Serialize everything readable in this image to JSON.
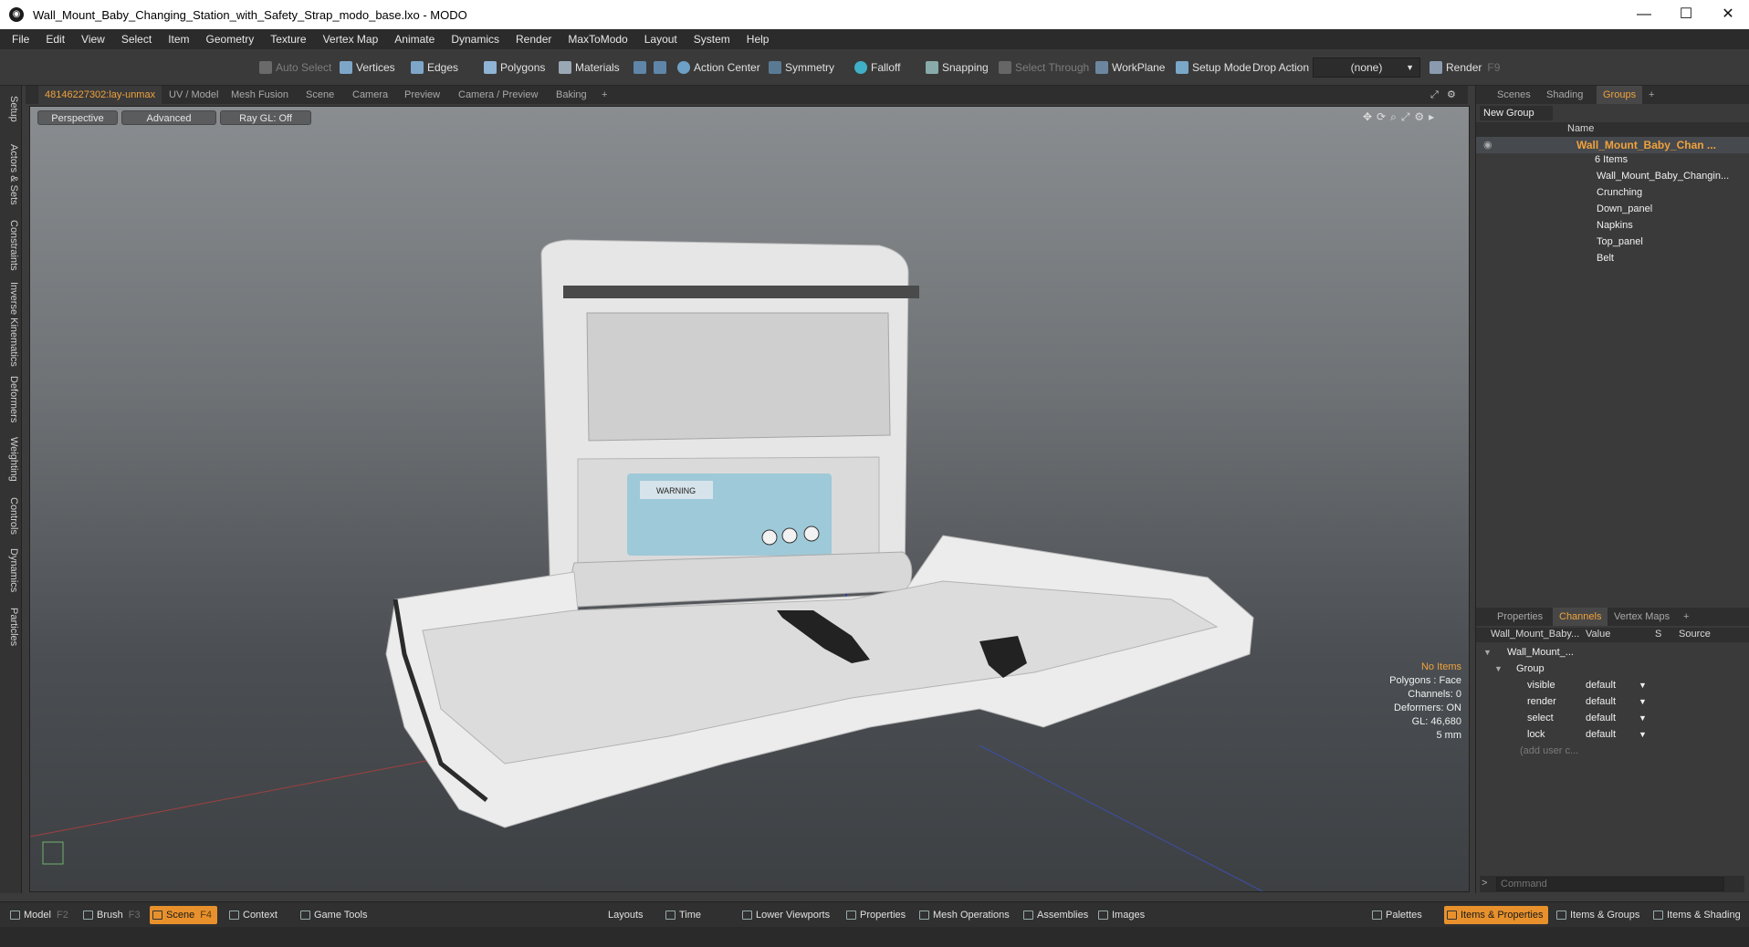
{
  "window": {
    "title": "Wall_Mount_Baby_Changing_Station_with_Safety_Strap_modo_base.lxo - MODO",
    "minimize": "—",
    "maximize": "☐",
    "close": "✕"
  },
  "menu": [
    "File",
    "Edit",
    "View",
    "Select",
    "Item",
    "Geometry",
    "Texture",
    "Vertex Map",
    "Animate",
    "Dynamics",
    "Render",
    "MaxToModo",
    "Layout",
    "System",
    "Help"
  ],
  "toolbar": {
    "auto_select": "Auto Select",
    "vertices": "Vertices",
    "edges": "Edges",
    "polygons": "Polygons",
    "materials": "Materials",
    "action_center": "Action Center",
    "symmetry": "Symmetry",
    "falloff": "Falloff",
    "snapping": "Snapping",
    "select_through": "Select Through",
    "workplane": "WorkPlane",
    "setup_mode": "Setup Mode",
    "drop_action_label": "Drop Action",
    "drop_action_value": "(none)",
    "render": "Render",
    "render_key": "F9"
  },
  "left_tabs": [
    "Setup",
    "Actors & Sets",
    "Constraints",
    "Inverse Kinematics",
    "Deformers",
    "Weighting",
    "Controls",
    "Dynamics",
    "Particles"
  ],
  "viewport_tabs": [
    "48146227302:lay-unmax",
    "UV / Model",
    "Mesh Fusion",
    "Scene",
    "Camera",
    "Preview",
    "Camera / Preview",
    "Baking",
    "+"
  ],
  "viewport": {
    "perspective": "Perspective",
    "advanced": "Advanced",
    "raygl": "Ray GL: Off",
    "hud": {
      "no_items": "No Items",
      "polygons": "Polygons : Face",
      "channels": "Channels: 0",
      "deformers": "Deformers: ON",
      "gl": "GL: 46,680",
      "unit": "5 mm"
    },
    "warning_label": "WARNING"
  },
  "scene_panel": {
    "tabs": [
      "Scenes",
      "Shading",
      "Groups",
      "+"
    ],
    "new_group": "New Group",
    "name_header": "Name",
    "root": "Wall_Mount_Baby_Chan ...",
    "root_count": "6 Items",
    "items": [
      "Wall_Mount_Baby_Changin...",
      "Crunching",
      "Down_panel",
      "Napkins",
      "Top_panel",
      "Belt"
    ]
  },
  "channels_panel": {
    "tabs": [
      "Properties",
      "Channels",
      "Vertex Maps",
      "+"
    ],
    "headers": {
      "name": "Wall_Mount_Baby...",
      "value": "Value",
      "s": "S",
      "source": "Source"
    },
    "root": "Wall_Mount_...",
    "group": "Group",
    "rows": [
      {
        "name": "visible",
        "value": "default"
      },
      {
        "name": "render",
        "value": "default"
      },
      {
        "name": "select",
        "value": "default"
      },
      {
        "name": "lock",
        "value": "default"
      }
    ],
    "add_user": "(add user c...",
    "command_placeholder": "Command"
  },
  "bottom": {
    "model": "Model",
    "model_key": "F2",
    "brush": "Brush",
    "brush_key": "F3",
    "scene": "Scene",
    "scene_key": "F4",
    "context": "Context",
    "game_tools": "Game Tools",
    "layouts": "Layouts",
    "time": "Time",
    "lower_viewports": "Lower Viewports",
    "properties": "Properties",
    "mesh_operations": "Mesh Operations",
    "assemblies": "Assemblies",
    "images": "Images",
    "palettes": "Palettes",
    "items_properties": "Items & Properties",
    "items_groups": "Items & Groups",
    "items_shading": "Items & Shading"
  },
  "colors": {
    "accent": "#f0a23c",
    "active_tab": "#e8912c"
  }
}
